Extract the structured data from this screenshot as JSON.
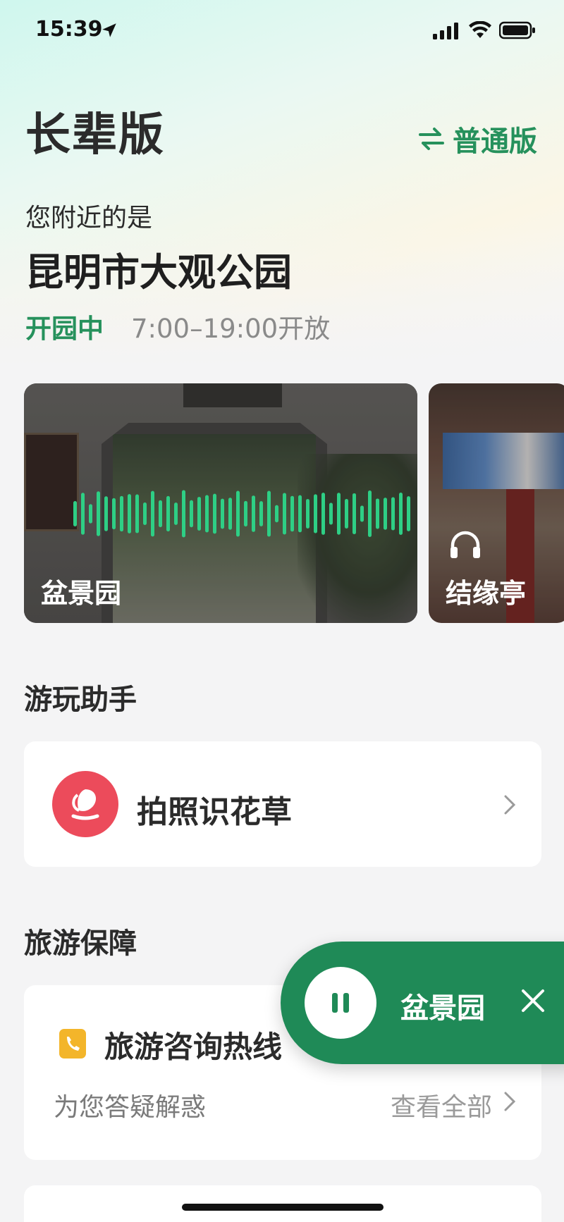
{
  "status_bar": {
    "time": "15:39"
  },
  "header": {
    "title": "长辈版",
    "switch_label": "普通版"
  },
  "location": {
    "near_label": "您附近的是",
    "place_name": "昆明市大观公园",
    "open_status": "开园中",
    "open_hours": "7:00–19:00开放"
  },
  "audio_cards": [
    {
      "label": "盆景园"
    },
    {
      "label": "结缘亭"
    }
  ],
  "assistant": {
    "section_title": "游玩助手",
    "items": [
      {
        "label": "拍照识花草"
      }
    ]
  },
  "guarantee": {
    "section_title": "旅游保障",
    "hotline_title": "旅游咨询热线",
    "hotline_subtitle": "为您答疑解惑",
    "view_all": "查看全部"
  },
  "player": {
    "label": "盆景园"
  },
  "colors": {
    "accent": "#1f8a57",
    "accent_text": "#26915c",
    "flower_icon": "#ec4b5b",
    "phone_icon": "#f3b52a"
  }
}
